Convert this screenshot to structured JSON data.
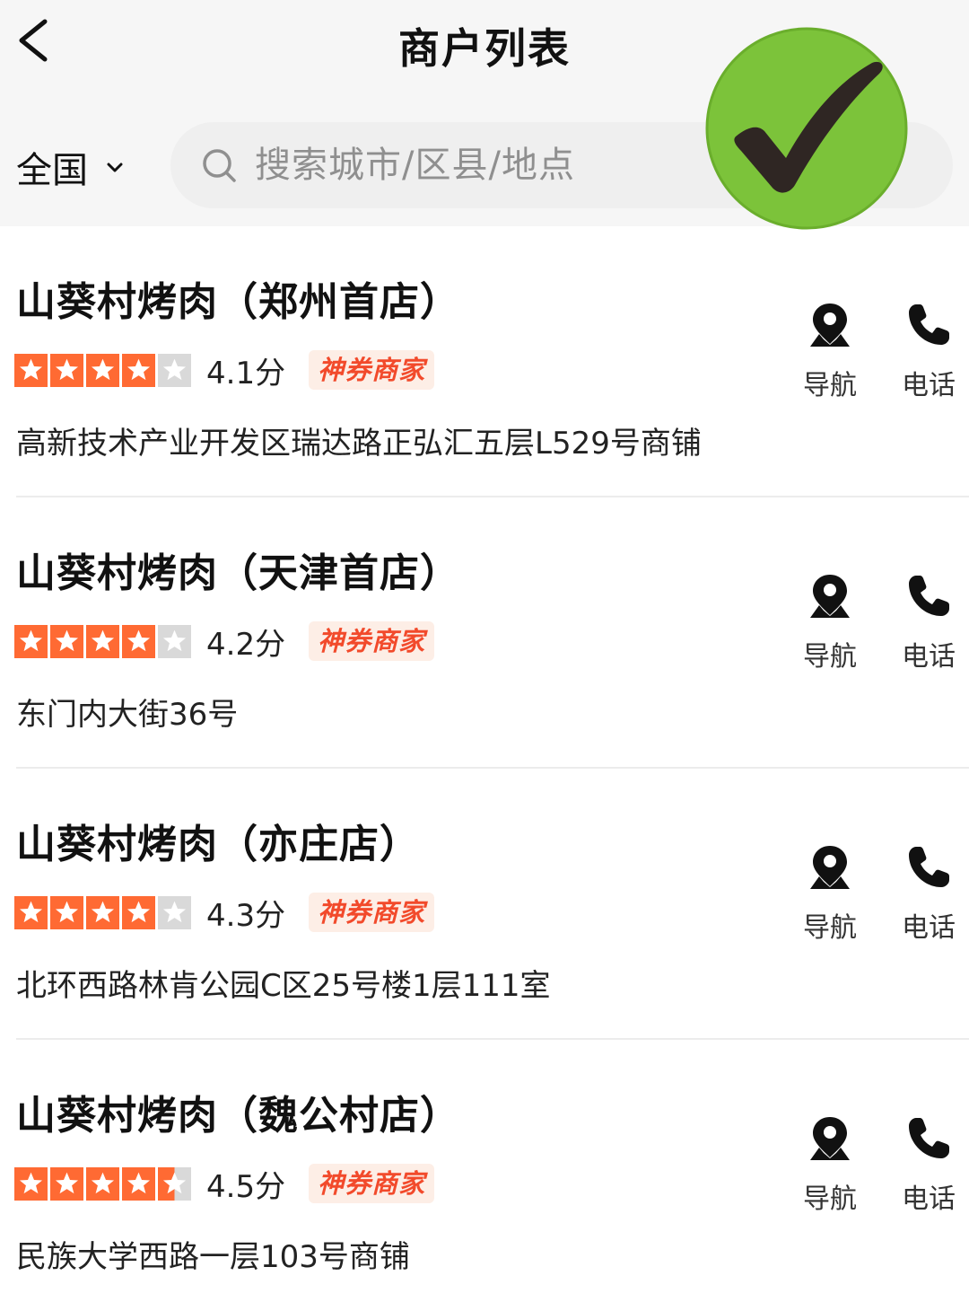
{
  "header": {
    "title": "商户列表",
    "back_icon": "chevron-left-icon"
  },
  "filter": {
    "region": "全国",
    "region_icon": "chevron-down-icon",
    "search_placeholder": "搜索城市/区县/地点",
    "search_icon": "search-icon"
  },
  "overlay": {
    "icon": "green-checkmark-icon",
    "color": "#7cc33a"
  },
  "colors": {
    "star": "#ff6a33",
    "star_empty": "#d9d9d9",
    "tag_text": "#f24a2b",
    "tag_bg": "#fdeee6"
  },
  "stores": [
    {
      "name": "山葵村烤肉（郑州首店）",
      "stars": 4,
      "score": "4.1分",
      "tag": "神券商家",
      "address": "高新技术产业开发区瑞达路正弘汇五层L529号商铺",
      "nav_label": "导航",
      "call_label": "电话"
    },
    {
      "name": "山葵村烤肉（天津首店）",
      "stars": 4,
      "score": "4.2分",
      "tag": "神券商家",
      "address": "东门内大街36号",
      "nav_label": "导航",
      "call_label": "电话"
    },
    {
      "name": "山葵村烤肉（亦庄店）",
      "stars": 4,
      "score": "4.3分",
      "tag": "神券商家",
      "address": "北环西路林肯公园C区25号楼1层111室",
      "nav_label": "导航",
      "call_label": "电话"
    },
    {
      "name": "山葵村烤肉（魏公村店）",
      "stars": 4.5,
      "score": "4.5分",
      "tag": "神券商家",
      "address": "民族大学西路一层103号商铺",
      "nav_label": "导航",
      "call_label": "电话"
    }
  ]
}
